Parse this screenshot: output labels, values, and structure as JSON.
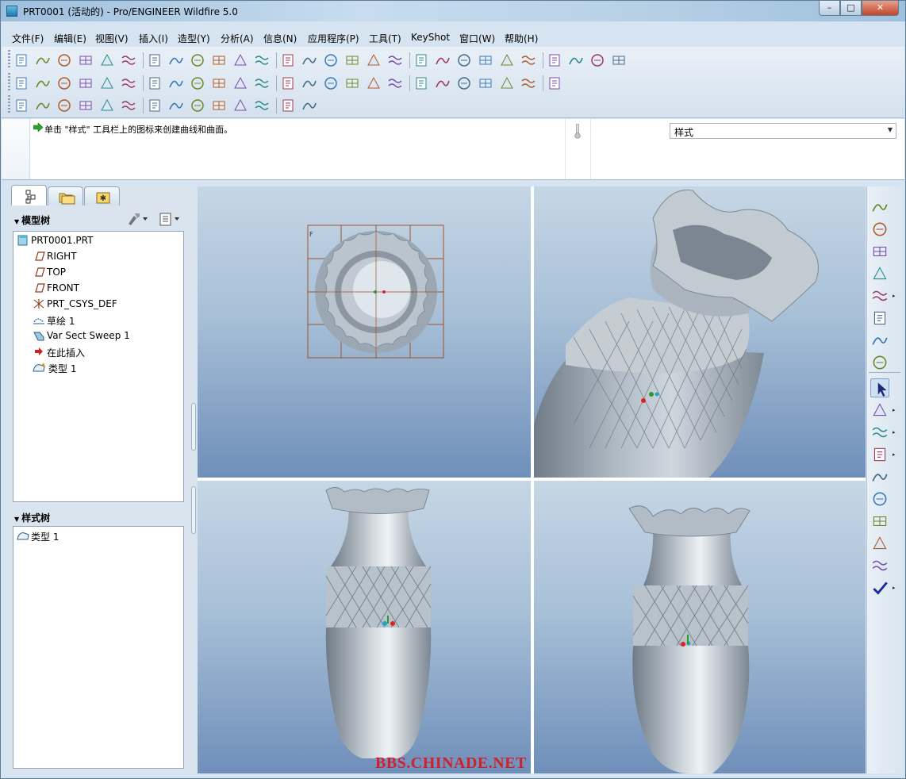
{
  "window": {
    "title": "PRT0001 (活动的) - Pro/ENGINEER Wildfire 5.0",
    "controls": {
      "minimize": "–",
      "maximize": "□",
      "close": "✕"
    }
  },
  "menubar": {
    "items": [
      "文件(F)",
      "编辑(E)",
      "视图(V)",
      "插入(I)",
      "造型(Y)",
      "分析(A)",
      "信息(N)",
      "应用程序(P)",
      "工具(T)",
      "KeyShot",
      "窗口(W)",
      "帮助(H)"
    ]
  },
  "toolbar": {
    "row1_icons": [
      "new-icon",
      "open-icon",
      "save-icon",
      "print-icon",
      "send-icon",
      "model-player-icon",
      "measure-icon",
      "section-icon",
      "grid-icon",
      "datum-display-icon",
      "curve-analysis-icon",
      "surface-analysis-icon",
      "reflection-icon",
      "shade-icon",
      "draft-icon",
      "slope-icon",
      "dihedral-icon",
      "offset-icon",
      "undo-icon",
      "redo-icon",
      "regenerate-icon",
      "cut-icon",
      "copy-icon",
      "paste-icon",
      "paste-special-icon",
      "traffic-light-icon",
      "find-icon",
      "selection-box-icon"
    ],
    "row2_icons": [
      "repaint-icon",
      "spin-center-icon",
      "orient-icon",
      "appearance-icon",
      "zoom-in-icon",
      "zoom-out-icon",
      "refit-icon",
      "view-manager-icon",
      "saved-views-icon",
      "layers-icon",
      "model-display-icon",
      "wireframe-icon",
      "hidden-line-icon",
      "no-hidden-icon",
      "shading-icon",
      "enhanced-realism-icon",
      "planes-icon",
      "axes-icon",
      "points-icon",
      "csys-icon",
      "annotation-icon",
      "active-plane-icon",
      "curves-on-icon",
      "grid-on-icon",
      "four-views-icon"
    ],
    "row3_icons": [
      "curve-icon",
      "surface-icon",
      "curvature-icon",
      "connection-icon",
      "trim-icon",
      "drape-icon",
      "fan-icon",
      "section-draft-icon",
      "reflect-analysis-icon",
      "deviation-icon",
      "delete-curve-icon",
      "delete-surface-icon",
      "delete-all-icon",
      "context-help-icon"
    ]
  },
  "message": {
    "text": "单击 \"样式\" 工具栏上的图标来创建曲线和曲面。",
    "filter_value": "样式"
  },
  "navigator": {
    "tabs": [
      "model-tree-tab",
      "folder-browser-tab",
      "favorites-tab"
    ],
    "model_tree_title": "模型树",
    "model_tree": [
      {
        "label": "PRT0001.PRT",
        "icon": "part-icon"
      },
      {
        "label": "RIGHT",
        "icon": "datum-plane-icon"
      },
      {
        "label": "TOP",
        "icon": "datum-plane-icon"
      },
      {
        "label": "FRONT",
        "icon": "datum-plane-icon"
      },
      {
        "label": "PRT_CSYS_DEF",
        "icon": "csys-icon"
      },
      {
        "label": "草绘 1",
        "icon": "sketch-icon"
      },
      {
        "label": "Var Sect Sweep 1",
        "icon": "sweep-icon"
      },
      {
        "label": "在此插入",
        "icon": "insert-here-icon"
      },
      {
        "label": "类型 1",
        "icon": "style-feature-icon"
      }
    ],
    "style_tree_title": "样式树",
    "style_tree": [
      {
        "label": "类型 1",
        "icon": "style-feature-icon"
      }
    ]
  },
  "viewports": {
    "top_left": "top-view",
    "top_right": "perspective-view",
    "bottom_left": "front-view",
    "bottom_right": "right-view",
    "small_label": "F"
  },
  "right_toolbar": {
    "icons": [
      "show-all-curves-icon",
      "active-plane-icon",
      "internal-plane-icon",
      "create-curve-icon",
      "create-point-icon",
      "create-csys-icon",
      "offset-curve-icon",
      "link-icon",
      "select-icon",
      "trim-surface-icon",
      "curve-edit-icon",
      "draw-curve-icon",
      "boundary-surface-icon",
      "surface-connect-icon",
      "surface-trim-icon",
      "surface-edit-icon",
      "style-edit-icon",
      "done-icon"
    ]
  },
  "watermark": "BBS.CHINADE.NET",
  "colors": {
    "title_bar": "#b8d0e6",
    "model": "#a9b7c4",
    "viewport_top": "#c6d6e5",
    "viewport_bottom": "#6f8fba",
    "watermark": "#d0202a",
    "datum": "#a0522d"
  }
}
